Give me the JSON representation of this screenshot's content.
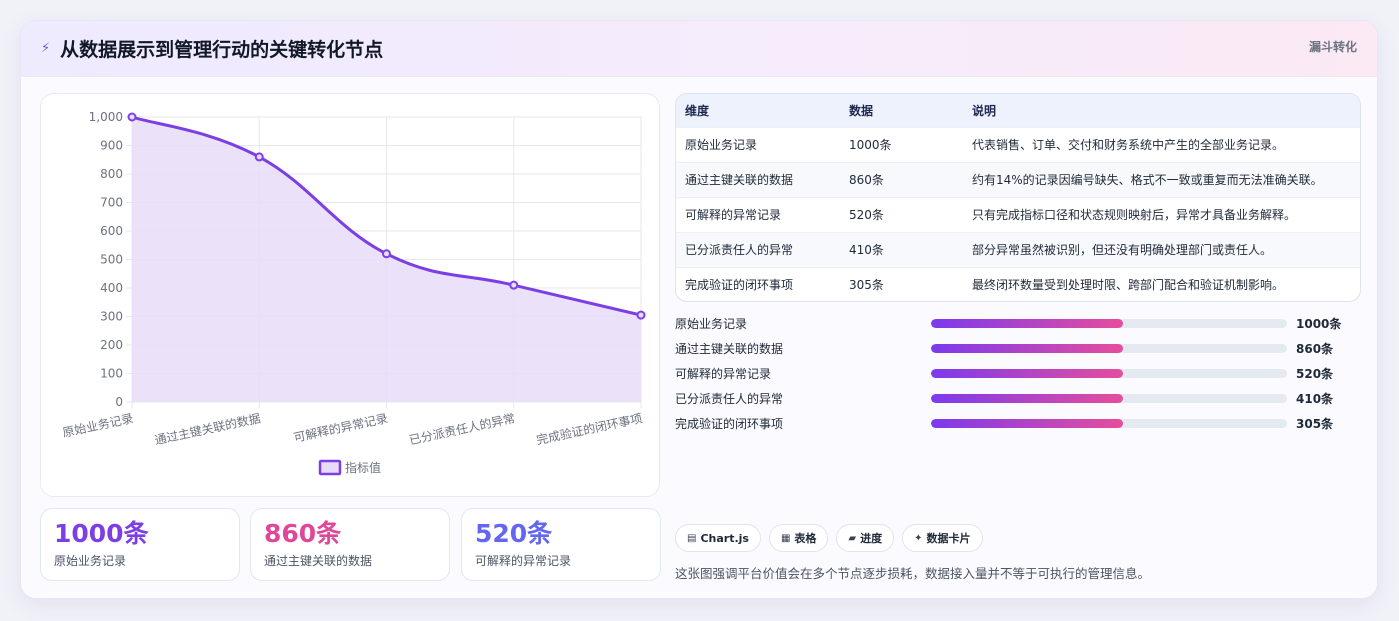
{
  "header": {
    "icon": "bolt-icon",
    "title": "从数据展示到管理行动的关键转化节点",
    "tag": "漏斗转化"
  },
  "chart_data": {
    "type": "area",
    "categories": [
      "原始业务记录",
      "通过主键关联的数据",
      "可解释的异常记录",
      "已分派责任人的异常",
      "完成验证的闭环事项"
    ],
    "series": [
      {
        "name": "指标值",
        "values": [
          1000,
          860,
          520,
          410,
          305
        ]
      }
    ],
    "yticks": [
      "0",
      "100",
      "200",
      "300",
      "400",
      "500",
      "600",
      "700",
      "800",
      "900",
      "1,000"
    ],
    "ylim": [
      0,
      1000
    ],
    "legend": "bottom",
    "grid": true,
    "colors": {
      "line": "#7b3fe4",
      "fill": "#e7dcf8"
    }
  },
  "kpis": [
    {
      "value": "1000条",
      "label": "原始业务记录",
      "color": "#7b3fe4"
    },
    {
      "value": "860条",
      "label": "通过主键关联的数据",
      "color": "#e0479a"
    },
    {
      "value": "520条",
      "label": "可解释的异常记录",
      "color": "#6366f1"
    }
  ],
  "table": {
    "headers": [
      "维度",
      "数据",
      "说明"
    ],
    "rows": [
      [
        "原始业务记录",
        "1000条",
        "代表销售、订单、交付和财务系统中产生的全部业务记录。"
      ],
      [
        "通过主键关联的数据",
        "860条",
        "约有14%的记录因编号缺失、格式不一致或重复而无法准确关联。"
      ],
      [
        "可解释的异常记录",
        "520条",
        "只有完成指标口径和状态规则映射后，异常才具备业务解释。"
      ],
      [
        "已分派责任人的异常",
        "410条",
        "部分异常虽然被识别，但还没有明确处理部门或责任人。"
      ],
      [
        "完成验证的闭环事项",
        "305条",
        "最终闭环数量受到处理时限、跨部门配合和验证机制影响。"
      ]
    ]
  },
  "bars": [
    {
      "label": "原始业务记录",
      "value": "1000条",
      "fill": 0.54
    },
    {
      "label": "通过主键关联的数据",
      "value": "860条",
      "fill": 0.54
    },
    {
      "label": "可解释的异常记录",
      "value": "520条",
      "fill": 0.54
    },
    {
      "label": "已分派责任人的异常",
      "value": "410条",
      "fill": 0.54
    },
    {
      "label": "完成验证的闭环事项",
      "value": "305条",
      "fill": 0.54
    }
  ],
  "pills": [
    {
      "icon": "chart-icon",
      "label": "Chart.js"
    },
    {
      "icon": "table-icon",
      "label": "表格"
    },
    {
      "icon": "progress-icon",
      "label": "进度"
    },
    {
      "icon": "card-icon",
      "label": "数据卡片"
    }
  ],
  "note": "这张图强调平台价值会在多个节点逐步损耗，数据接入量并不等于可执行的管理信息。"
}
